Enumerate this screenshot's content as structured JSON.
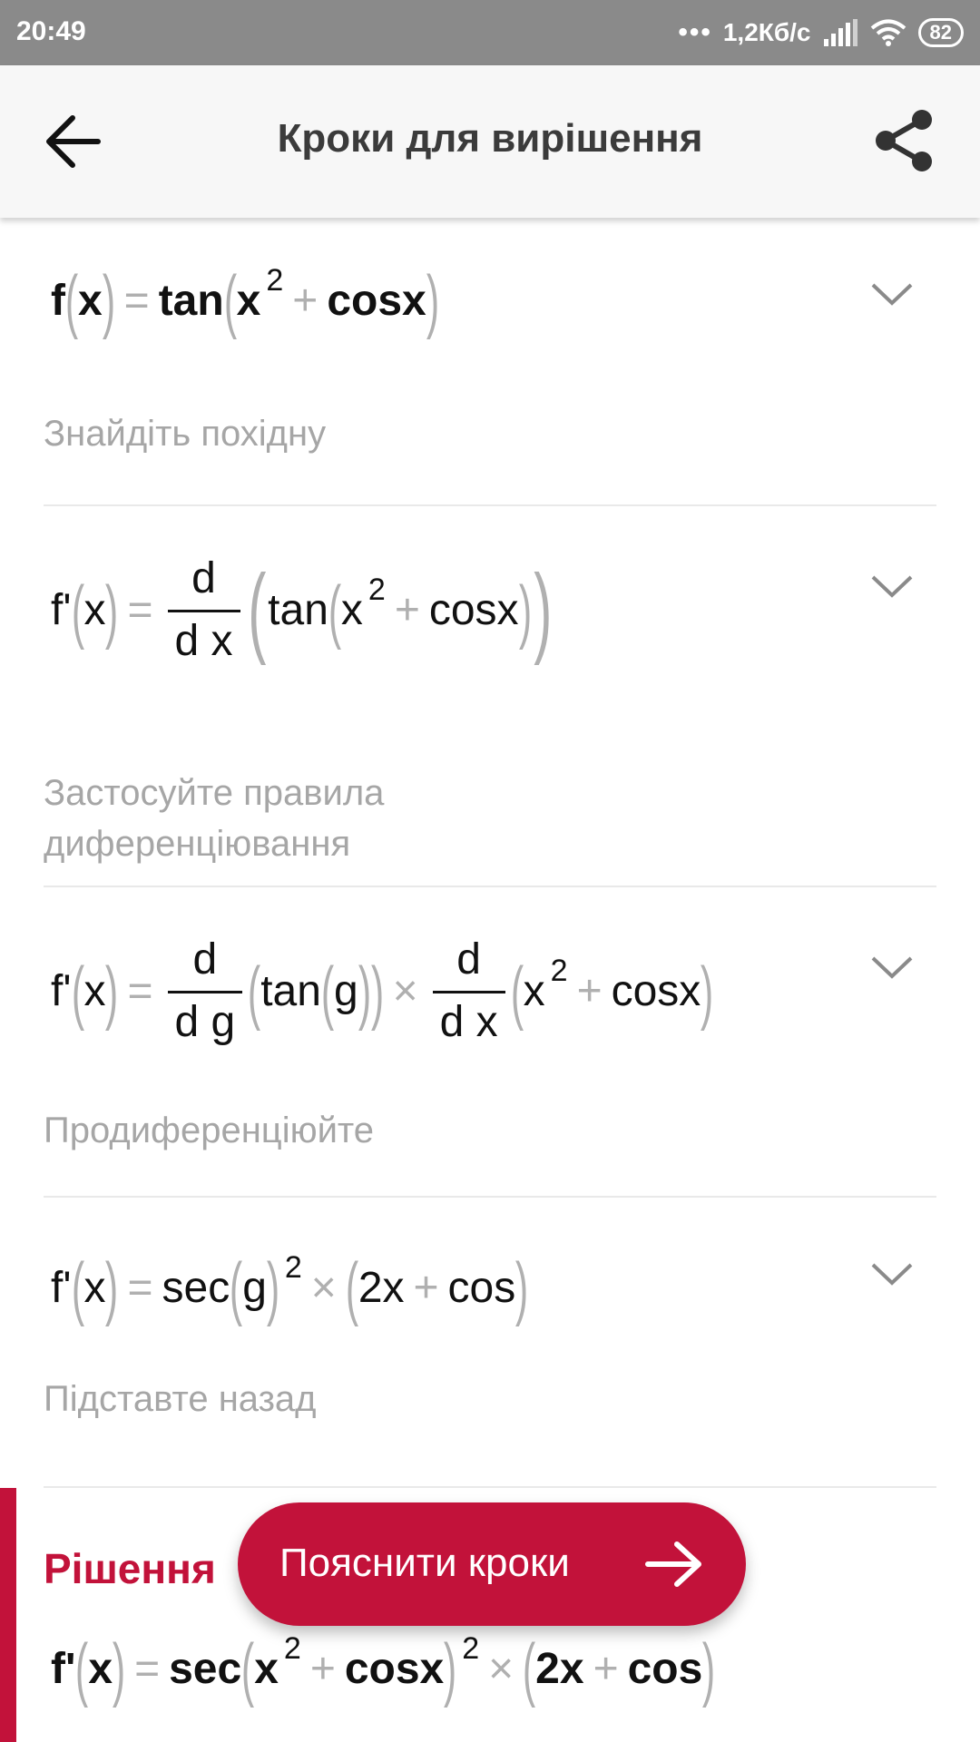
{
  "status_bar": {
    "time": "20:49",
    "network_speed": "1,2Кб/с",
    "battery": "82"
  },
  "header": {
    "title": "Кроки для вирішення"
  },
  "steps": [
    {
      "eq": {
        "fn": "f",
        "arg": "x",
        "eq": "=",
        "func": "tan",
        "base": "x",
        "exp": "2",
        "plus": "+",
        "term": "cosx"
      },
      "description": "Знайдіть похідну"
    },
    {
      "eq": {
        "fn": "f'",
        "arg": "x",
        "eq": "=",
        "dnum": "d",
        "dden": "d x",
        "func": "tan",
        "base": "x",
        "exp": "2",
        "plus": "+",
        "term": "cosx"
      },
      "description": "Застосуйте правила диференціювання"
    },
    {
      "eq": {
        "fn": "f'",
        "arg": "x",
        "eq": "=",
        "dnum": "d",
        "dden": "d g",
        "func": "tan",
        "inner": "g",
        "times": "×",
        "dnum2": "d",
        "dden2": "d x",
        "base": "x",
        "exp": "2",
        "plus": "+",
        "term": "cosx"
      },
      "description": "Продиференціюйте"
    },
    {
      "eq": {
        "fn": "f'",
        "arg": "x",
        "eq": "=",
        "func": "sec",
        "inner": "g",
        "exp": "2",
        "times": "×",
        "a": "2x",
        "plus": "+",
        "term": "cos"
      },
      "description": "Підставте назад"
    }
  ],
  "solution": {
    "title": "Рішення",
    "eq": {
      "fn": "f'",
      "arg": "x",
      "eq": "=",
      "func": "sec",
      "base": "x",
      "exp": "2",
      "plus": "+",
      "term": "cosx",
      "exp2": "2",
      "times": "×",
      "a": "2x",
      "plus2": "+",
      "term2": "cos"
    }
  },
  "fab": {
    "label": "Пояснити кроки"
  },
  "colors": {
    "accent": "#c2123a",
    "status_bar": "#8a8a8a",
    "muted_text": "#a6a6a6"
  },
  "icons": {
    "back": "arrow-left-icon",
    "share": "share-icon",
    "expand": "chevron-down-icon",
    "fab": "arrow-right-icon"
  }
}
